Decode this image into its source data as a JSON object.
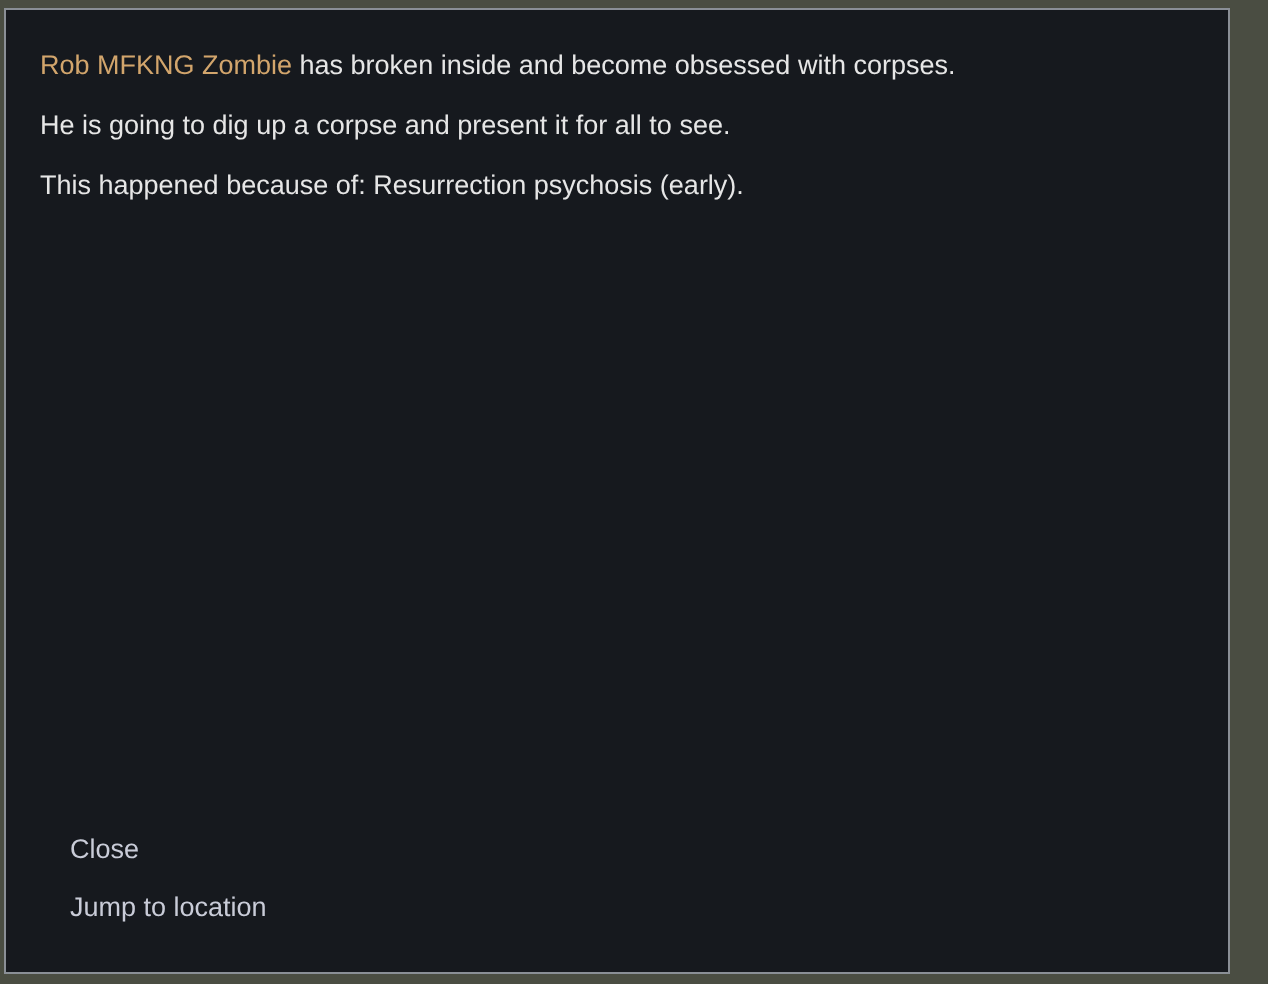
{
  "dialog": {
    "paragraphs": [
      {
        "name": "Rob MFKNG Zombie",
        "text": " has broken inside and become obsessed with corpses."
      },
      {
        "text": "He is going to dig up a corpse and present it for all to see."
      },
      {
        "text": "This happened because of: Resurrection psychosis (early)."
      }
    ],
    "options": [
      "Close",
      "Jump to location"
    ]
  }
}
